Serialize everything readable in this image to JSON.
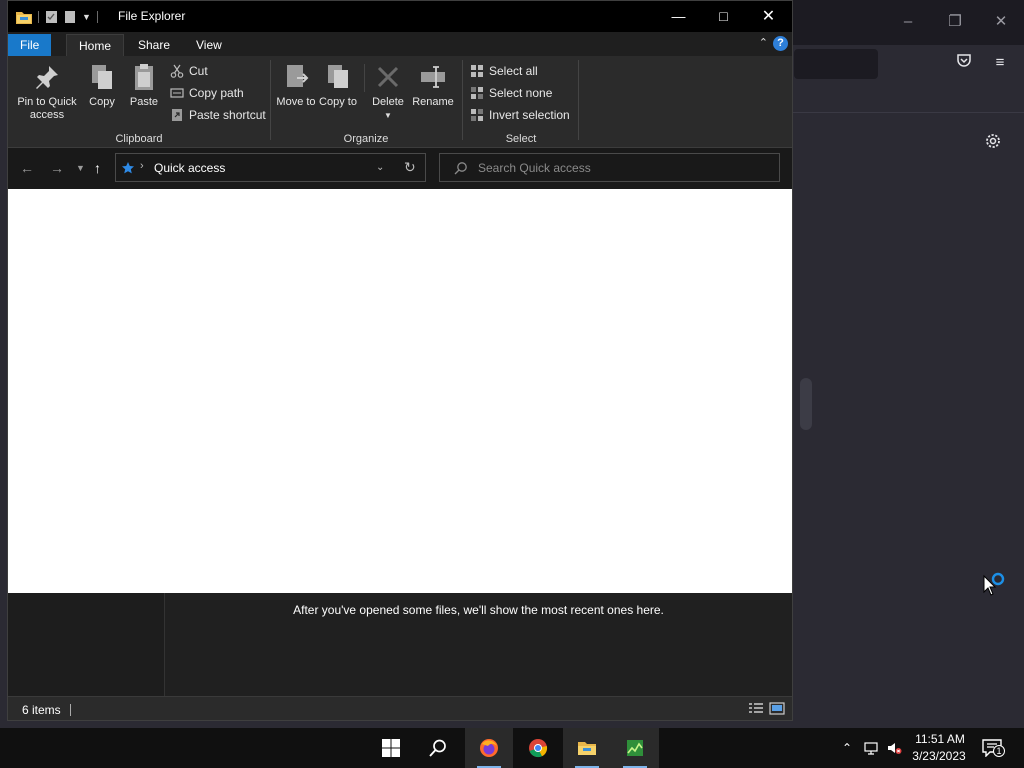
{
  "window": {
    "title": "File Explorer",
    "minimize_icon": "minimize-icon",
    "maximize_icon": "maximize-icon",
    "close_icon": "close-icon"
  },
  "ribbon_tabs": {
    "file": "File",
    "home": "Home",
    "share": "Share",
    "view": "View",
    "help": "?"
  },
  "clipboard": {
    "label": "Clipboard",
    "pin": "Pin to Quick access",
    "copy": "Copy",
    "paste": "Paste",
    "cut": "Cut",
    "copy_path": "Copy path",
    "paste_shortcut": "Paste shortcut"
  },
  "organize": {
    "label": "Organize",
    "move_to": "Move to",
    "copy_to": "Copy to",
    "delete": "Delete",
    "rename": "Rename"
  },
  "select": {
    "label": "Select",
    "select_all": "Select all",
    "select_none": "Select none",
    "invert": "Invert selection"
  },
  "address": {
    "location": "Quick access",
    "search_placeholder": "Search Quick access"
  },
  "content": {
    "recent_message": "After you've opened some files, we'll show the most recent ones here."
  },
  "status": {
    "item_count": "6 items"
  },
  "clock": {
    "time": "11:51 AM",
    "date": "3/23/2023"
  },
  "notifications": {
    "count": "1"
  },
  "colors": {
    "accent": "#1979ca",
    "titlebar": "#000000",
    "ribbon": "#2b2b2b",
    "taskbar": "#101010"
  }
}
